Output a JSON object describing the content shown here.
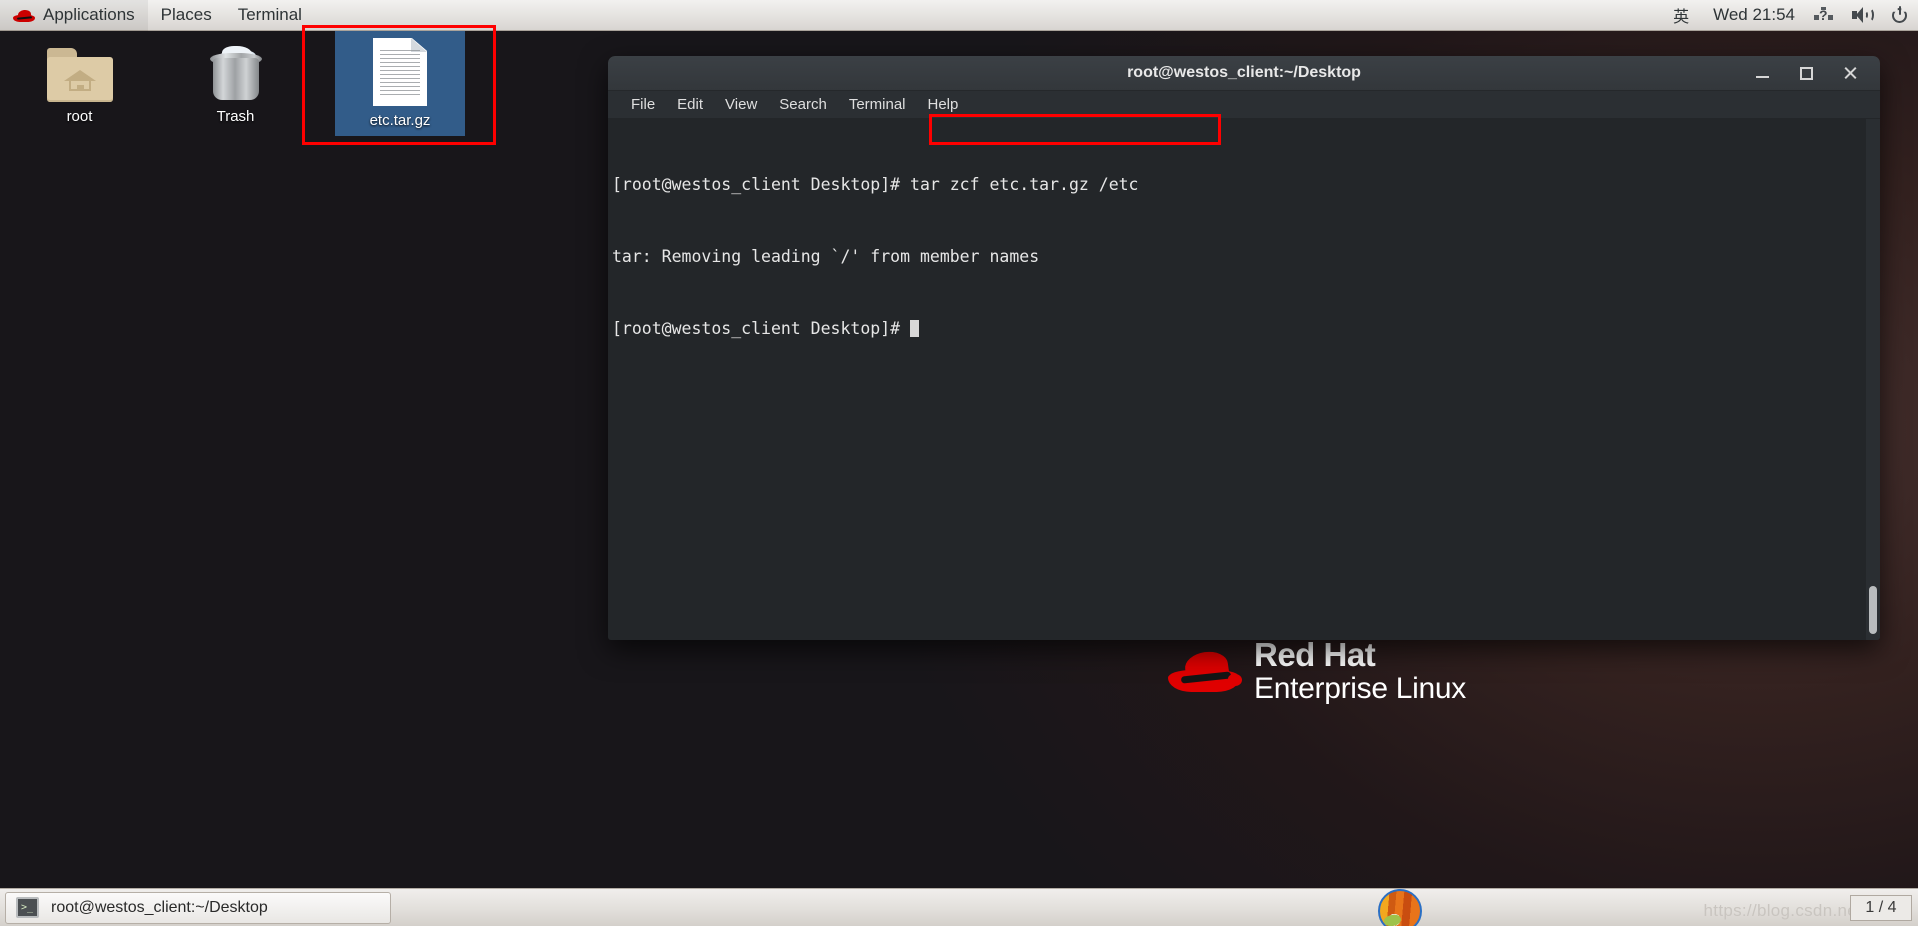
{
  "top_panel": {
    "logo_icon": "redhat-logo-icon",
    "menus": [
      {
        "label": "Applications"
      },
      {
        "label": "Places"
      },
      {
        "label": "Terminal"
      }
    ],
    "input_method": "英",
    "clock": "Wed 21:54",
    "tray": [
      {
        "icon": "network-question-icon"
      },
      {
        "icon": "volume-speaker-icon"
      },
      {
        "icon": "power-icon"
      }
    ]
  },
  "desktop": {
    "icons": [
      {
        "label": "root",
        "icon": "home-folder-icon",
        "selected": false
      },
      {
        "label": "Trash",
        "icon": "trash-can-icon",
        "selected": false
      },
      {
        "label": "etc.tar.gz",
        "icon": "document-file-icon",
        "selected": true
      }
    ],
    "branding": {
      "line1": "Red Hat",
      "line2": "Enterprise Linux",
      "logo_icon": "redhat-hat-icon"
    }
  },
  "terminal": {
    "title": "root@westos_client:~/Desktop",
    "window_controls": {
      "minimize": "minimize-icon",
      "maximize": "maximize-icon",
      "close": "close-icon"
    },
    "menu": [
      {
        "label": "File"
      },
      {
        "label": "Edit"
      },
      {
        "label": "View"
      },
      {
        "label": "Search"
      },
      {
        "label": "Terminal"
      },
      {
        "label": "Help"
      }
    ],
    "lines": [
      {
        "prompt": "[root@westos_client Desktop]# ",
        "command": "tar zcf etc.tar.gz /etc"
      },
      {
        "prompt": "",
        "command": "tar: Removing leading `/' from member names"
      },
      {
        "prompt": "[root@westos_client Desktop]# ",
        "command": ""
      }
    ]
  },
  "taskbar": {
    "window_button": {
      "label": "root@westos_client:~/Desktop",
      "icon": "terminal-icon"
    },
    "favorite_icon": "application-icon",
    "watermark": "https://blog.csdn.net",
    "workspace": "1 / 4"
  },
  "annotations": [
    {
      "name": "file-highlight",
      "target": "etc.tar.gz desktop icon"
    },
    {
      "name": "command-highlight",
      "target": "tar zcf etc.tar.gz /etc"
    }
  ],
  "colors": {
    "accent_red": "#fe0000",
    "selection_blue": "#3a6ea5",
    "terminal_bg": "#232629",
    "panel_bg": "#e3e1de"
  }
}
